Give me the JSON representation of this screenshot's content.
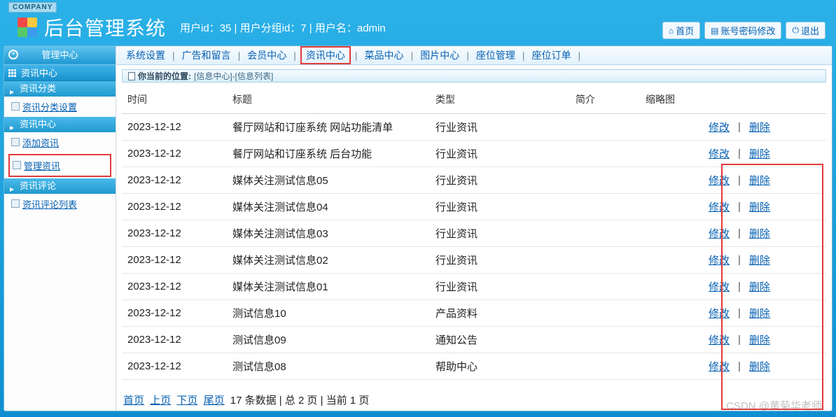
{
  "brand_badge": "COMPANY",
  "title": "后台管理系统",
  "user_line": "用户id：35 | 用户分组id：7 | 用户名：admin",
  "topbuttons": {
    "home": "首页",
    "pwd": "账号密码修改",
    "exit": "退出"
  },
  "sidebar": {
    "top": "管理中心",
    "section": "资讯中心",
    "groups": [
      {
        "title": "资讯分类",
        "links": [
          {
            "label": "资讯分类设置",
            "hl": false
          }
        ]
      },
      {
        "title": "资讯中心",
        "links": [
          {
            "label": "添加资讯",
            "hl": false
          },
          {
            "label": "管理资讯",
            "hl": true
          }
        ]
      },
      {
        "title": "资讯评论",
        "links": [
          {
            "label": "资讯评论列表",
            "hl": false
          }
        ]
      }
    ]
  },
  "nav": [
    {
      "label": "系统设置",
      "hl": false
    },
    {
      "label": "广告和留言",
      "hl": false
    },
    {
      "label": "会员中心",
      "hl": false
    },
    {
      "label": "资讯中心",
      "hl": true
    },
    {
      "label": "菜品中心",
      "hl": false
    },
    {
      "label": "图片中心",
      "hl": false
    },
    {
      "label": "座位管理",
      "hl": false
    },
    {
      "label": "座位订单",
      "hl": false
    }
  ],
  "breadcrumb": {
    "prefix": "你当前的位置:",
    "path": "[信息中心]-[信息列表]"
  },
  "columns": {
    "time": "时间",
    "title": "标题",
    "type": "类型",
    "intro": "简介",
    "thumb": "缩略图"
  },
  "ops": {
    "edit": "修改",
    "del": "删除"
  },
  "rows": [
    {
      "time": "2023-12-12",
      "title": "餐厅网站和订座系统 网站功能清单",
      "type": "行业资讯"
    },
    {
      "time": "2023-12-12",
      "title": "餐厅网站和订座系统 后台功能",
      "type": "行业资讯"
    },
    {
      "time": "2023-12-12",
      "title": "媒体关注测试信息05",
      "type": "行业资讯"
    },
    {
      "time": "2023-12-12",
      "title": "媒体关注测试信息04",
      "type": "行业资讯"
    },
    {
      "time": "2023-12-12",
      "title": "媒体关注测试信息03",
      "type": "行业资讯"
    },
    {
      "time": "2023-12-12",
      "title": "媒体关注测试信息02",
      "type": "行业资讯"
    },
    {
      "time": "2023-12-12",
      "title": "媒体关注测试信息01",
      "type": "行业资讯"
    },
    {
      "time": "2023-12-12",
      "title": "测试信息10",
      "type": "产品资料"
    },
    {
      "time": "2023-12-12",
      "title": "测试信息09",
      "type": "通知公告"
    },
    {
      "time": "2023-12-12",
      "title": "测试信息08",
      "type": "帮助中心"
    }
  ],
  "pager": {
    "first": "首页",
    "prev": "上页",
    "next": "下页",
    "last": "尾页",
    "info": "17 条数据 | 总 2 页 | 当前 1 页"
  },
  "watermark": "CSDN @黄菊华老师"
}
